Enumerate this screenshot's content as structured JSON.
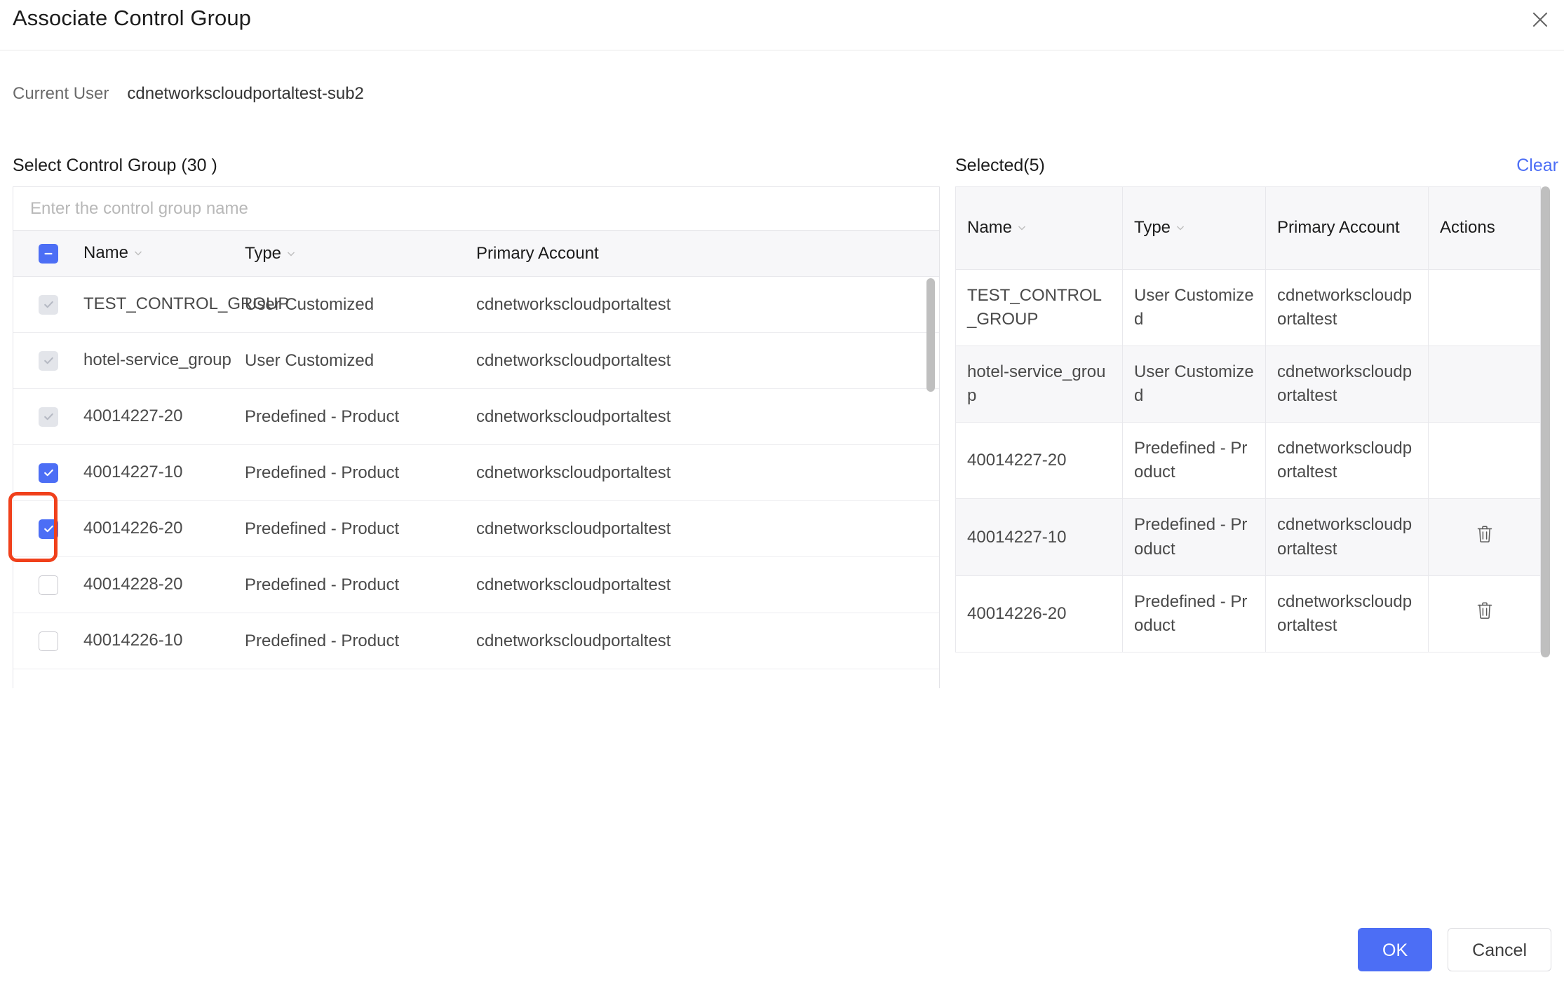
{
  "dialog": {
    "title": "Associate Control Group",
    "close_icon": "close-icon"
  },
  "current_user": {
    "label": "Current User",
    "value": "cdnetworkscloudportaltest-sub2"
  },
  "left": {
    "title": "Select Control Group (30 )",
    "search_placeholder": "Enter the control group name",
    "search_value": "",
    "header_checkbox_state": "indeterminate",
    "columns": [
      "Name",
      "Type",
      "Primary Account"
    ],
    "rows": [
      {
        "name": "TEST_CONTROL_GROUP",
        "type": "User Customized",
        "account": "cdnetworkscloudportaltest",
        "checkbox": "disabled-checked"
      },
      {
        "name": "hotel-service_group",
        "type": "User Customized",
        "account": "cdnetworkscloudportaltest",
        "checkbox": "disabled-checked"
      },
      {
        "name": "40014227-20",
        "type": "Predefined - Product",
        "account": "cdnetworkscloudportaltest",
        "checkbox": "disabled-checked"
      },
      {
        "name": "40014227-10",
        "type": "Predefined - Product",
        "account": "cdnetworkscloudportaltest",
        "checkbox": "checked"
      },
      {
        "name": "40014226-20",
        "type": "Predefined - Product",
        "account": "cdnetworkscloudportaltest",
        "checkbox": "checked"
      },
      {
        "name": "40014228-20",
        "type": "Predefined - Product",
        "account": "cdnetworkscloudportaltest",
        "checkbox": "empty"
      },
      {
        "name": "40014226-10",
        "type": "Predefined - Product",
        "account": "cdnetworkscloudportaltest",
        "checkbox": "empty"
      }
    ]
  },
  "right": {
    "title": "Selected(5)",
    "clear_label": "Clear",
    "columns": [
      "Name",
      "Type",
      "Primary Account",
      "Actions"
    ],
    "rows": [
      {
        "name": "TEST_CONTROL_GROUP",
        "type": "User Customized",
        "account": "cdnetworkscloudportaltest",
        "action": ""
      },
      {
        "name": "hotel-service_group",
        "type": "User Customized",
        "account": "cdnetworkscloudportaltest",
        "action": ""
      },
      {
        "name": "40014227-20",
        "type": "Predefined - Product",
        "account": "cdnetworkscloudportaltest",
        "action": ""
      },
      {
        "name": "40014227-10",
        "type": "Predefined - Product",
        "account": "cdnetworkscloudportaltest",
        "action": "delete-icon"
      },
      {
        "name": "40014226-20",
        "type": "Predefined - Product",
        "account": "cdnetworkscloudportaltest",
        "action": "delete-icon"
      }
    ]
  },
  "footer": {
    "ok_label": "OK",
    "cancel_label": "Cancel"
  },
  "colors": {
    "accent": "#4c6ef5",
    "link": "#4c6ef5",
    "annotation": "#f0401b",
    "header_bg": "#f7f7f9",
    "border": "#e8e8ec"
  }
}
